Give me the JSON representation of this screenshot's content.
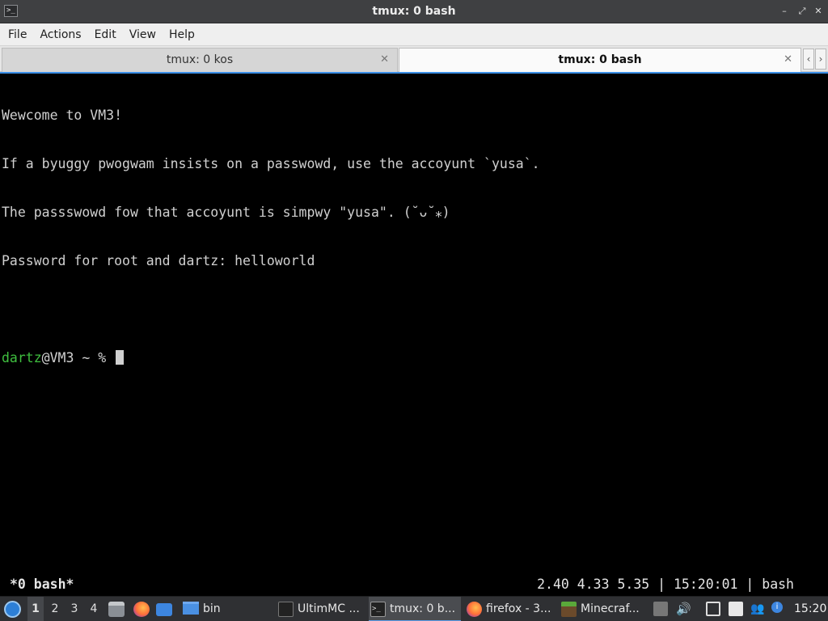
{
  "window": {
    "title": "tmux: 0 bash",
    "icon_glyph": ">_",
    "controls": {
      "minimize": "–",
      "maximize": "⤢",
      "close": "✕"
    }
  },
  "menu": [
    "File",
    "Actions",
    "Edit",
    "View",
    "Help"
  ],
  "tabs": [
    {
      "label": "tmux: 0 kos",
      "active": false
    },
    {
      "label": "tmux: 0 bash",
      "active": true
    }
  ],
  "tab_scroll": {
    "left": "‹",
    "right": "›"
  },
  "terminal": {
    "lines": [
      "Wewcome to VM3!",
      "If a byuggy pwogwam insists on a passwowd, use the accoyunt `yusa`.",
      "The passswowd fow that accoyunt is simpwy \"yusa\". (˘ᴗ˘⁎)",
      "Password for root and dartz: helloworld",
      ""
    ],
    "prompt": {
      "user": "dartz",
      "rest": "@VM3 ~ % "
    }
  },
  "tmux": {
    "window": "*0 bash*",
    "right": "2.40 4.33 5.35 | 15:20:01 | bash"
  },
  "taskbar": {
    "workspaces": [
      "1",
      "2",
      "3",
      "4"
    ],
    "quick_launch": [
      "file-manager-icon",
      "firefox-icon",
      "show-desktop-icon"
    ],
    "folder": "bin",
    "tasks": [
      "UltimMC ...",
      "tmux: 0 b...",
      "firefox - 3...",
      "Minecraf..."
    ],
    "tray": {
      "volume_glyph": "🔊",
      "user_glyph": "👥",
      "info_glyph": "i"
    },
    "clock": "15:20"
  }
}
